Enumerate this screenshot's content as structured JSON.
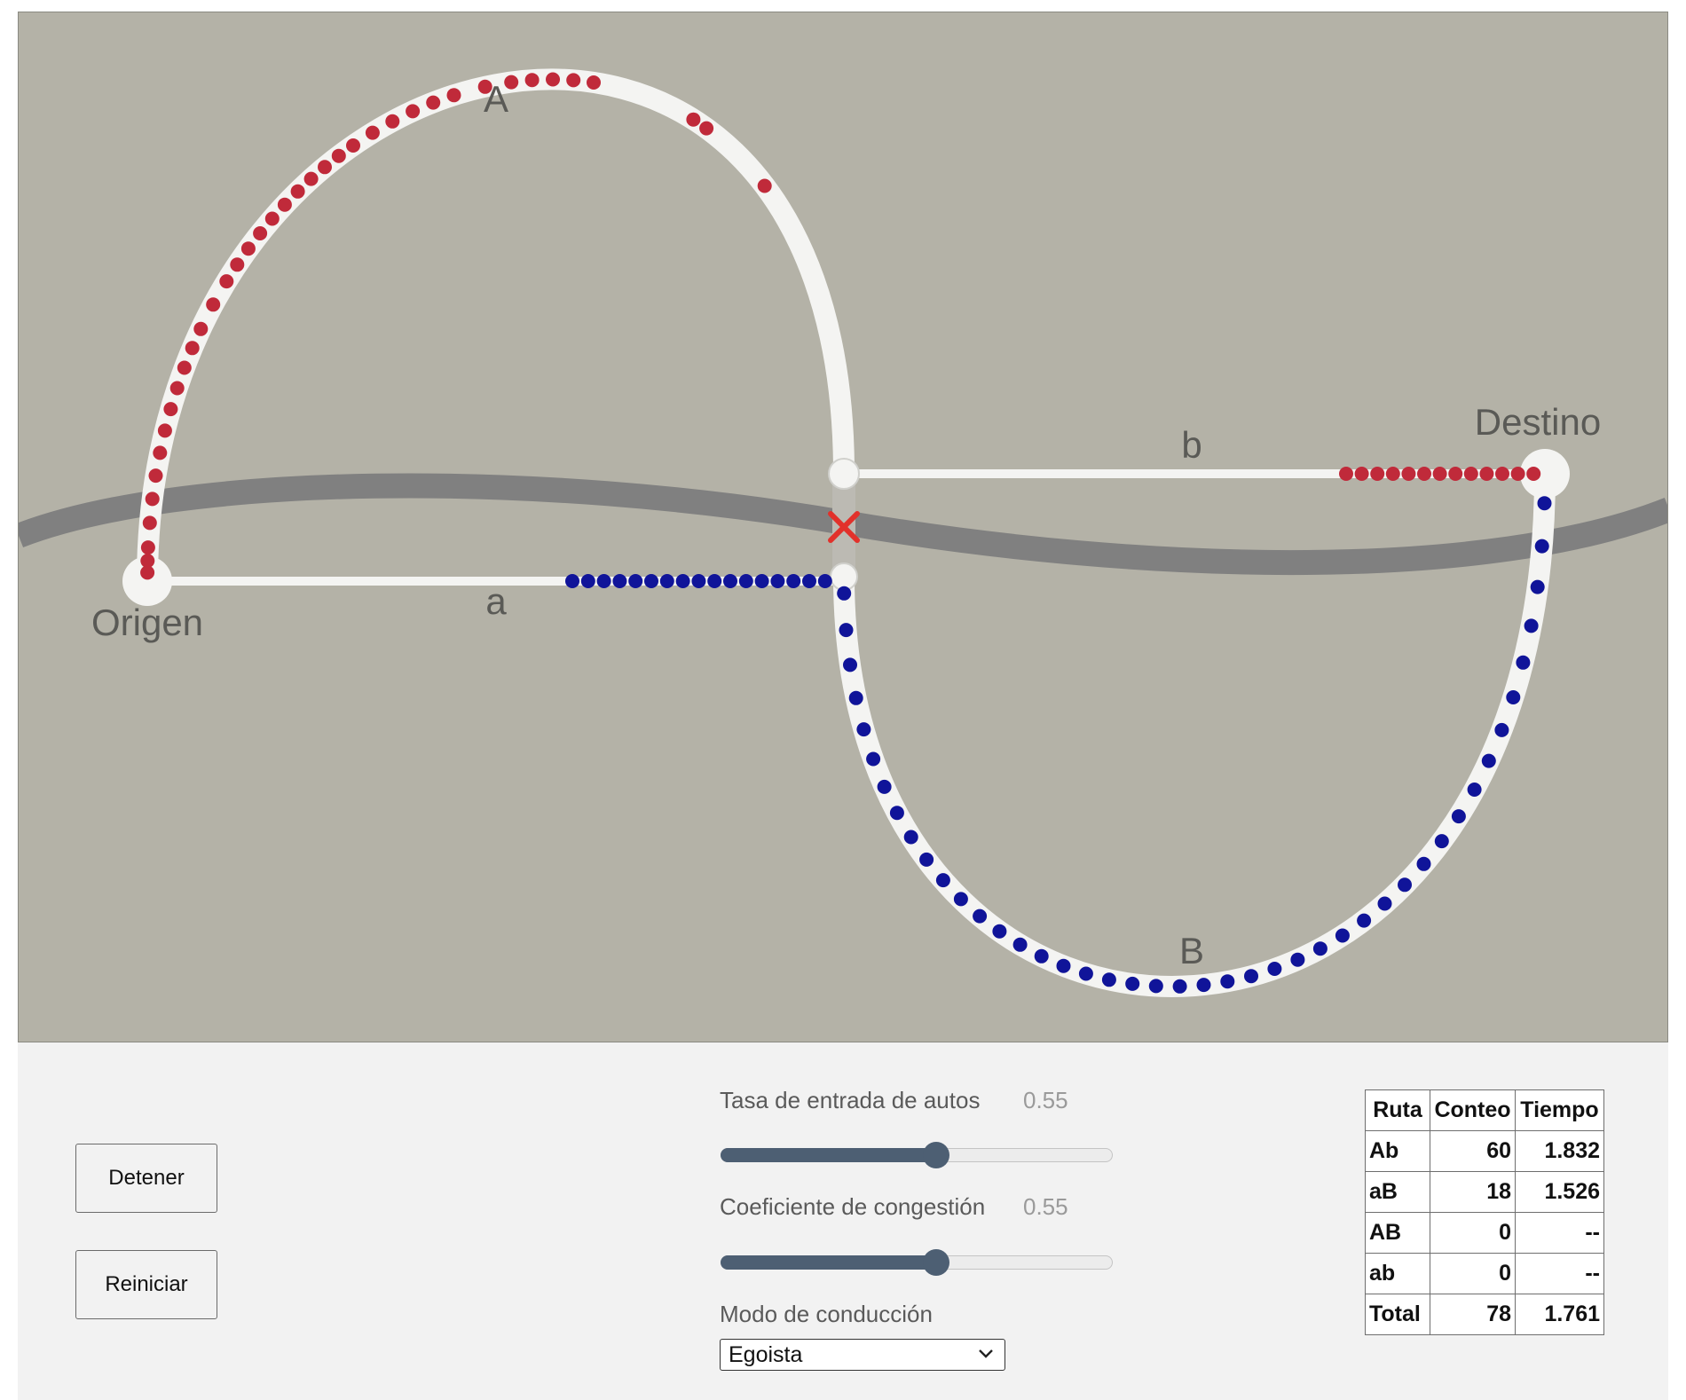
{
  "simulation": {
    "labels": {
      "origin": "Origen",
      "destination": "Destino",
      "route_A": "A",
      "route_B": "B",
      "route_a": "a",
      "route_b": "b"
    },
    "colors": {
      "background": "#b4b2a7",
      "road": "#f4f4f2",
      "river": "#808080",
      "car_Ab": "#c02a3a",
      "car_aB": "#101499",
      "blocked_marker": "#e2312b"
    },
    "bridge_blocked": true,
    "cars_by_route": {
      "Ab_visible": 56,
      "aB_visible": 60
    }
  },
  "controls": {
    "stop_button": "Detener",
    "reset_button": "Reiniciar",
    "car_rate": {
      "label": "Tasa de entrada de autos",
      "value": "0.55",
      "fraction": 0.55
    },
    "congestion": {
      "label": "Coeficiente de congestión",
      "value": "0.55",
      "fraction": 0.55
    },
    "driving_mode": {
      "label": "Modo de conducción",
      "selected": "Egoista"
    }
  },
  "stats": {
    "headers": [
      "Ruta",
      "Conteo",
      "Tiempo"
    ],
    "rows": [
      {
        "route": "Ab",
        "count": "60",
        "time": "1.832"
      },
      {
        "route": "aB",
        "count": "18",
        "time": "1.526"
      },
      {
        "route": "AB",
        "count": "0",
        "time": "--"
      },
      {
        "route": "ab",
        "count": "0",
        "time": "--"
      },
      {
        "route": "Total",
        "count": "78",
        "time": "1.761"
      }
    ]
  }
}
